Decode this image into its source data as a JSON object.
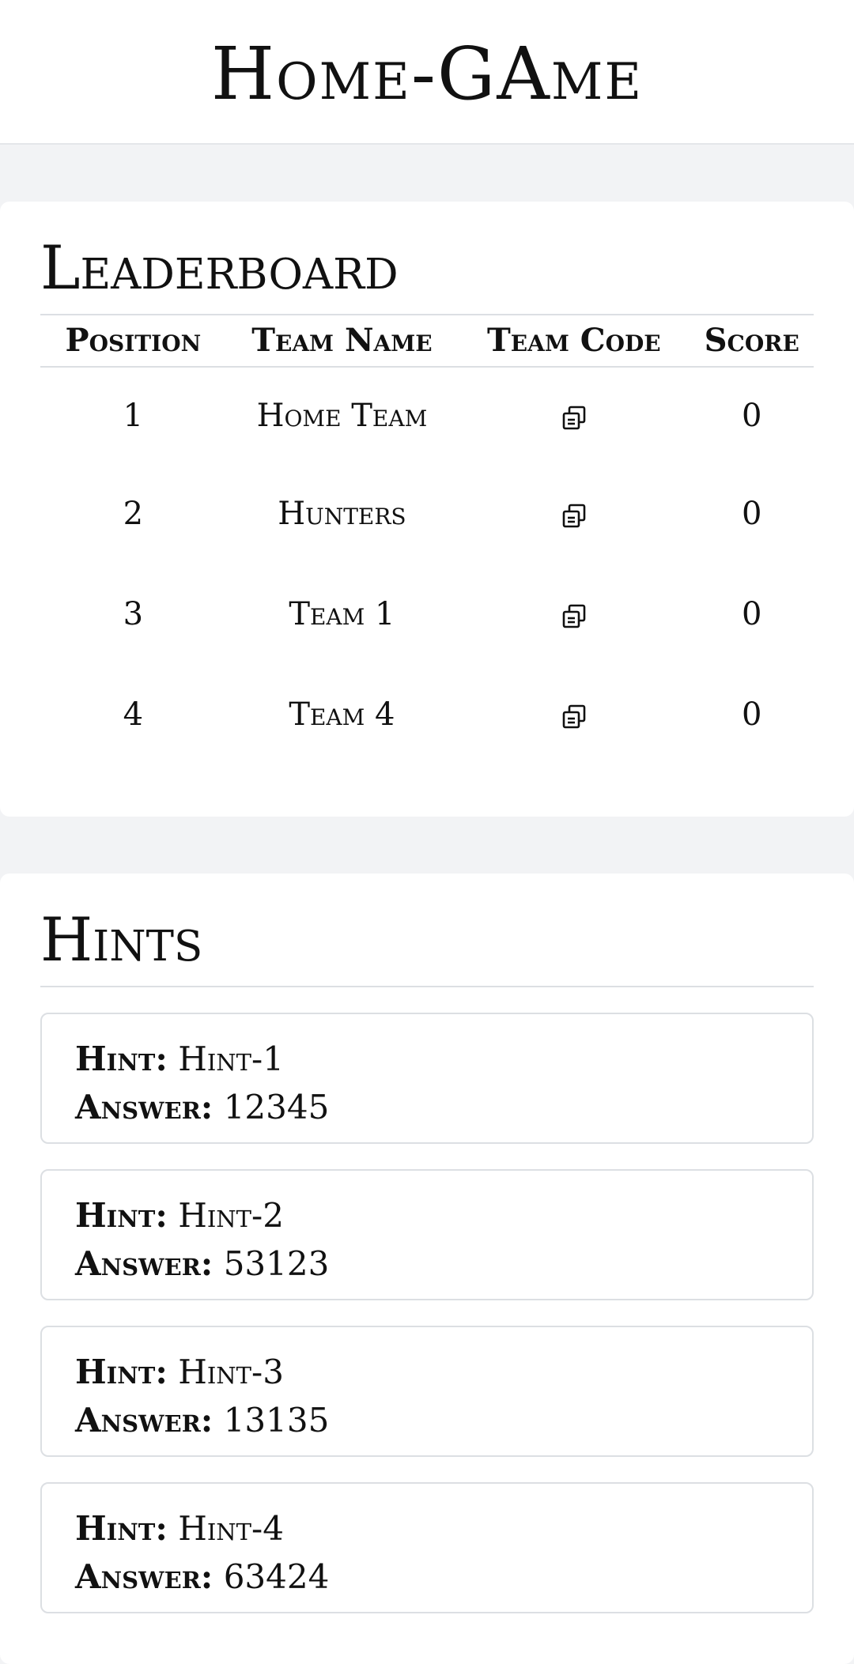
{
  "app": {
    "title": "Home-GAme"
  },
  "leaderboard": {
    "title": "Leaderboard",
    "columns": [
      "Position",
      "Team Name",
      "Team Code",
      "Score"
    ],
    "rows": [
      {
        "position": "1",
        "team_name": "Home Team",
        "team_code_icon": "copy-icon",
        "score": "0"
      },
      {
        "position": "2",
        "team_name": "Hunters",
        "team_code_icon": "copy-icon",
        "score": "0"
      },
      {
        "position": "3",
        "team_name": "Team 1",
        "team_code_icon": "copy-icon",
        "score": "0"
      },
      {
        "position": "4",
        "team_name": "Team 4",
        "team_code_icon": "copy-icon",
        "score": "0"
      }
    ]
  },
  "hints": {
    "title": "Hints",
    "hint_key": "Hint:",
    "answer_key": "Answer:",
    "items": [
      {
        "hint": "Hint-1",
        "answer": "12345"
      },
      {
        "hint": "Hint-2",
        "answer": "53123"
      },
      {
        "hint": "Hint-3",
        "answer": "13135"
      },
      {
        "hint": "Hint-4",
        "answer": "63424"
      }
    ]
  },
  "colors": {
    "page_background": "#f2f3f5",
    "card_background": "#ffffff",
    "border": "#dcdfe3",
    "text": "#111111"
  }
}
